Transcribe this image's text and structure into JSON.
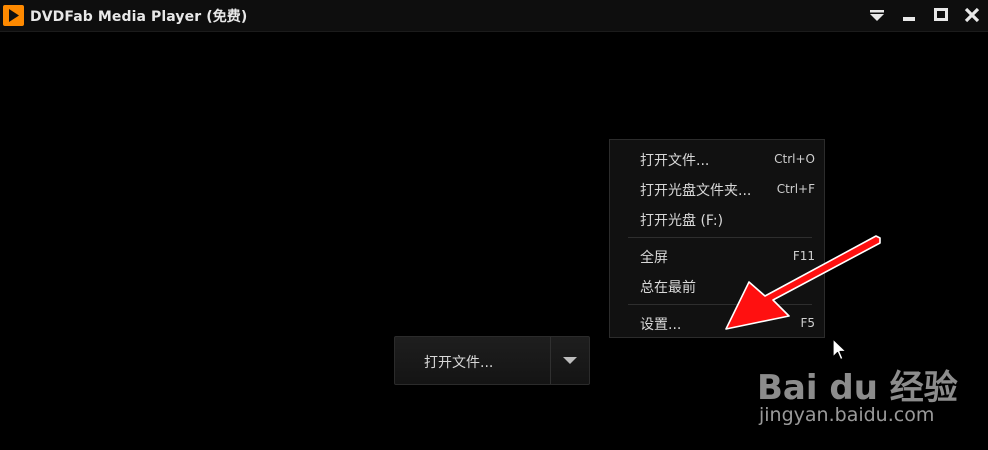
{
  "window": {
    "title": "DVDFab Media Player (免费)"
  },
  "titlebar": {
    "icons": [
      "app-play-icon",
      "menu-dropdown-icon",
      "minimize-icon",
      "maximize-icon",
      "close-icon"
    ]
  },
  "menu": {
    "items": [
      {
        "label": "打开文件...",
        "shortcut": "Ctrl+O"
      },
      {
        "label": "打开光盘文件夹...",
        "shortcut": "Ctrl+F"
      },
      {
        "label": "打开光盘 (F:)",
        "shortcut": ""
      },
      {
        "label": "全屏",
        "shortcut": "F11"
      },
      {
        "label": "总在最前",
        "shortcut": ""
      },
      {
        "label": "设置...",
        "shortcut": "F5"
      }
    ]
  },
  "open_button": {
    "label": "打开文件..."
  },
  "watermark": {
    "logo": "Bai du 经验",
    "url": "jingyan.baidu.com"
  },
  "colors": {
    "background": "#000000",
    "app_icon": "#ff8a00",
    "annotation_arrow": "#ff1010"
  }
}
